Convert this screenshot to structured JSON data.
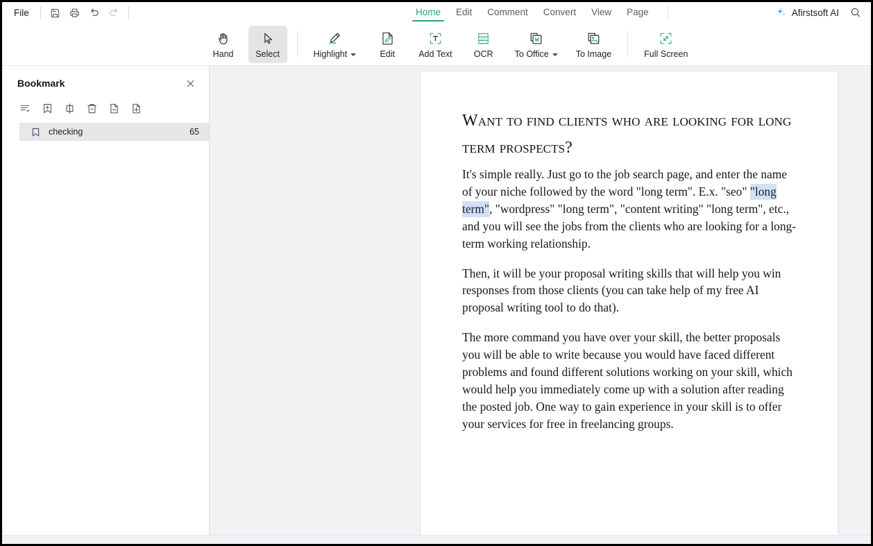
{
  "titlebar": {
    "file_label": "File",
    "quick_actions": [
      {
        "name": "save-icon",
        "tooltip": "Save"
      },
      {
        "name": "print-icon",
        "tooltip": "Print"
      },
      {
        "name": "undo-icon",
        "tooltip": "Undo"
      },
      {
        "name": "redo-icon",
        "tooltip": "Redo"
      }
    ],
    "tabs": [
      {
        "label": "Home",
        "active": true
      },
      {
        "label": "Edit",
        "active": false
      },
      {
        "label": "Comment",
        "active": false
      },
      {
        "label": "Convert",
        "active": false
      },
      {
        "label": "View",
        "active": false
      },
      {
        "label": "Page",
        "active": false
      }
    ],
    "ai_label": "Afirstsoft AI",
    "ai_icon": "sparkle-icon",
    "search_icon": "search-icon",
    "active_tab_color": "#2aa578"
  },
  "ribbon": {
    "buttons": [
      {
        "label": "Hand",
        "icon": "hand-icon",
        "active": false,
        "dropdown": false
      },
      {
        "label": "Select",
        "icon": "cursor-arrow-icon",
        "active": true,
        "dropdown": false
      },
      {
        "label": "Highlight",
        "icon": "highlight-pen-icon",
        "active": false,
        "dropdown": true
      },
      {
        "label": "Edit",
        "icon": "edit-document-icon",
        "active": false,
        "dropdown": false
      },
      {
        "label": "Add Text",
        "icon": "add-text-icon",
        "active": false,
        "dropdown": false
      },
      {
        "label": "OCR",
        "icon": "ocr-icon",
        "active": false,
        "dropdown": false
      },
      {
        "label": "To Office",
        "icon": "to-office-icon",
        "active": false,
        "dropdown": true
      },
      {
        "label": "To Image",
        "icon": "to-image-icon",
        "active": false,
        "dropdown": false
      },
      {
        "label": "Full Screen",
        "icon": "full-screen-icon",
        "active": false,
        "dropdown": false
      }
    ],
    "accent_color": "#2f9d74"
  },
  "sidebar": {
    "title": "Bookmark",
    "close_icon": "close-icon",
    "tools": [
      {
        "name": "collapse-all-icon"
      },
      {
        "name": "add-bookmark-icon"
      },
      {
        "name": "expand-bookmark-icon"
      },
      {
        "name": "delete-bookmark-icon"
      },
      {
        "name": "page-remove-icon"
      },
      {
        "name": "page-add-icon"
      }
    ],
    "bookmarks": [
      {
        "label": "checking",
        "page": "65",
        "selected": true,
        "icon": "bookmark-icon"
      }
    ]
  },
  "document": {
    "heading": "Want to find clients who are looking for long term prospects?",
    "paragraphs": [
      {
        "before": "It's simple really. Just go to the job search page, and enter the name of your niche followed by the word \"long term\". E.x. \"seo\" ",
        "selected": "\"long term\"",
        "after": ", \"wordpress\" \"long term\", \"content writing\" \"long term\", etc., and you will see the jobs from the clients who are looking for a long-term working relationship."
      },
      {
        "before": "Then, it will be your proposal writing skills that will help you win responses from those clients (you can take help of my free AI proposal writing tool to do that).",
        "selected": "",
        "after": ""
      },
      {
        "before": "The more command you have over your skill, the better proposals you will be able to write because you would have faced different problems and found different solutions working on your skill, which would help you immediately come up with a solution after reading the posted job. One way to gain experience in your skill is to offer your services for free in freelancing groups.",
        "selected": "",
        "after": ""
      }
    ],
    "selection_color": "#cfe0f7"
  }
}
